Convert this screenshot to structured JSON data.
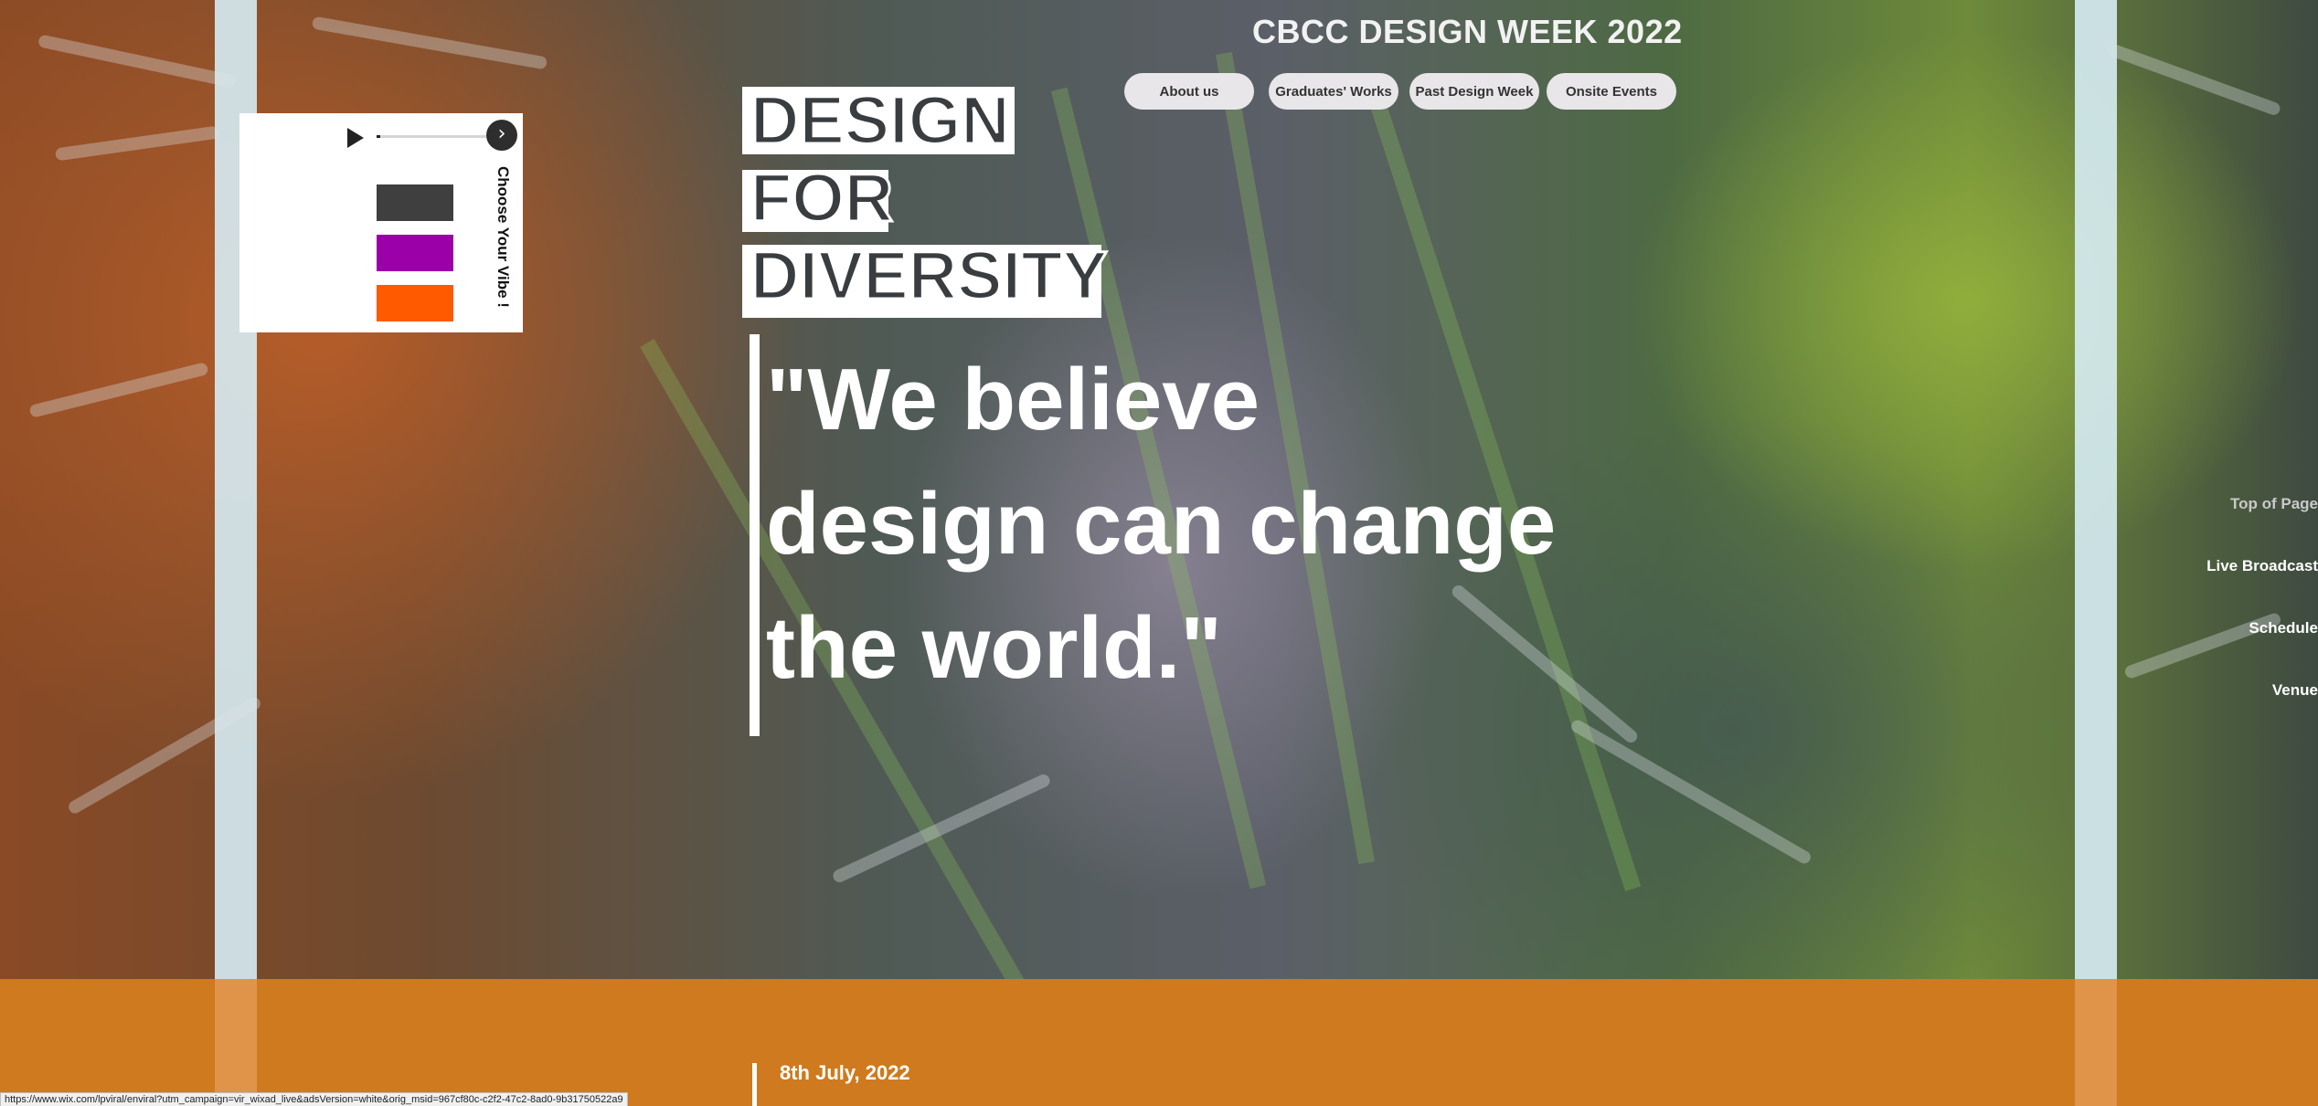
{
  "site": {
    "title": "CBCC DESIGN WEEK 2022"
  },
  "nav": {
    "items": [
      {
        "label": "About us"
      },
      {
        "label": "Graduates' Works"
      },
      {
        "label": "Past Design Week"
      },
      {
        "label": "Onsite Events"
      }
    ]
  },
  "headline": {
    "lines": [
      "DESIGN",
      "FOR",
      "DIVERSITY"
    ]
  },
  "quote": {
    "lines": [
      "\"We believe",
      "design can change",
      "the world.\""
    ]
  },
  "music_widget": {
    "vibe_label": "Choose Your Vibe !",
    "progress": 0,
    "swatches": [
      {
        "name": "dark-gray",
        "color": "#3f3f3f"
      },
      {
        "name": "purple",
        "color": "#9b00a8"
      },
      {
        "name": "orange",
        "color": "#ff5a00"
      }
    ]
  },
  "side_nav": {
    "items": [
      {
        "label": "Top of Page",
        "color": "#c9c9c9"
      },
      {
        "label": "Live Broadcast",
        "color": "#ffffff"
      },
      {
        "label": "Schedule",
        "color": "#ffffff"
      },
      {
        "label": "Venue",
        "color": "#ffffff"
      }
    ]
  },
  "event": {
    "date": "8th July, 2022"
  },
  "status_bar": {
    "url": "https://www.wix.com/lpviral/enviral?utm_campaign=vir_wixad_live&adsVersion=white&orig_msid=967cf80c-c2f2-47c2-8ad0-9b31750522a9"
  },
  "colors": {
    "band": "#cf7a1e",
    "nav_button": "#e9e6e9",
    "stripe": "#d6ecf4"
  }
}
